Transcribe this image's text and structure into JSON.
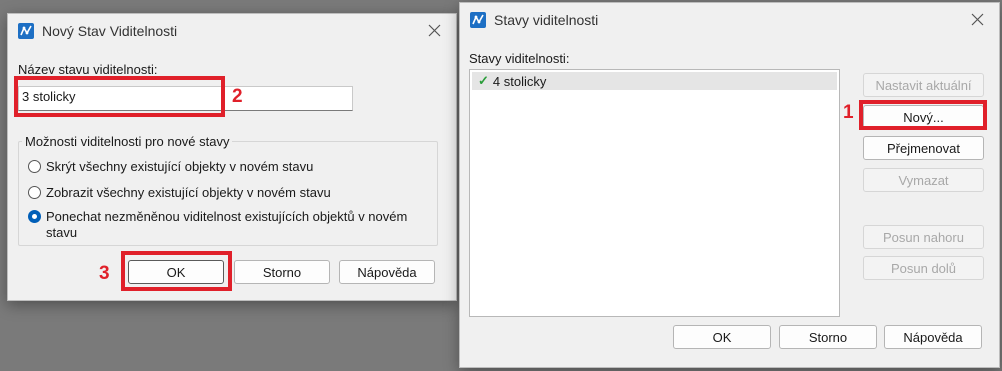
{
  "new_state_dialog": {
    "title": "Nový Stav Viditelnosti",
    "name_label": "Název stavu viditelnosti:",
    "name_value": "3 stolicky",
    "options_group_title": "Možnosti viditelnosti pro nové stavy",
    "options": [
      {
        "label": "Skrýt všechny existující objekty v novém stavu",
        "checked": false
      },
      {
        "label": "Zobrazit všechny existující objekty v novém stavu",
        "checked": false
      },
      {
        "label": "Ponechat nezměněnou viditelnost existujících objektů v novém stavu",
        "checked": true
      }
    ],
    "ok_label": "OK",
    "cancel_label": "Storno",
    "help_label": "Nápověda"
  },
  "states_dialog": {
    "title": "Stavy viditelnosti",
    "list_label": "Stavy viditelnosti:",
    "items": [
      {
        "label": "4 stolicky",
        "current": true
      }
    ],
    "set_current_label": "Nastavit aktuální",
    "new_label": "Nový...",
    "rename_label": "Přejmenovat",
    "delete_label": "Vymazat",
    "move_up_label": "Posun nahoru",
    "move_down_label": "Posun dolů",
    "ok_label": "OK",
    "cancel_label": "Storno",
    "help_label": "Nápověda"
  },
  "annotations": {
    "step1": "1",
    "step2": "2",
    "step3": "3",
    "highlight_color": "#e0202a"
  },
  "icons": {
    "app": "visibility-state-icon",
    "close": "close-icon",
    "check": "check-icon"
  }
}
